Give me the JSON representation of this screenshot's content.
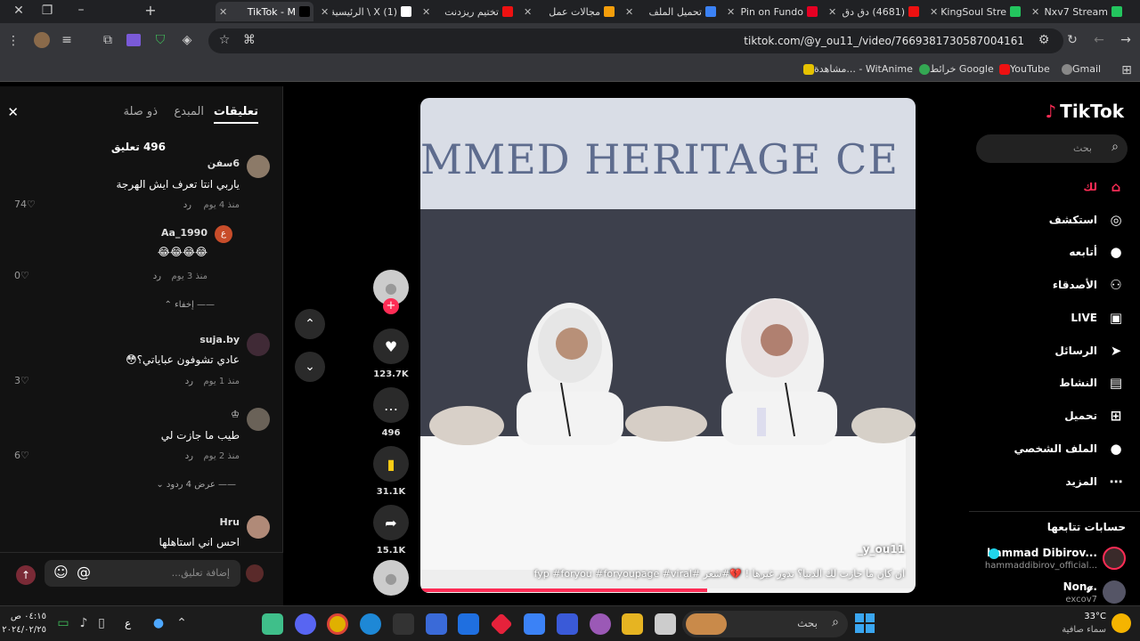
{
  "browser": {
    "tabs": [
      {
        "label": "Nxv7 Stream",
        "color": "#23c55e"
      },
      {
        "label": "KingSoul Stre",
        "color": "#23c55e"
      },
      {
        "label": "(4681) دق دق",
        "color": "#e11"
      },
      {
        "label": "Pin on Fundo",
        "color": "#e60023"
      },
      {
        "label": "تحميل الملف",
        "color": "#3b82f6"
      },
      {
        "label": "مجالات عمل",
        "color": "#f59e0b"
      },
      {
        "label": "تختيم ريزدنت",
        "color": "#e11"
      },
      {
        "label": "(1) X \\ الرئيسية",
        "color": "#fff"
      },
      {
        "label": "TikTok - M",
        "color": "#000"
      }
    ],
    "url": "tiktok.com/@y_ou11_/video/7669381730587004161",
    "bookmarks": [
      "Gmail",
      "YouTube",
      "خرائط Google",
      "مشاهدة... - WitAnime"
    ]
  },
  "comments_panel": {
    "tabs": [
      "تعليقات",
      "المبدع",
      "ذو صلة"
    ],
    "count": "496 تعليق",
    "comments": [
      {
        "user": "6سفن",
        "text": "ياربي انتا تعرف ايش الهرجة",
        "time": "منذ 4 يوم",
        "reply": "رد",
        "likes": "74"
      },
      {
        "user": "Aa_1990",
        "badge": "ع",
        "text": "😂😂😂😂",
        "time": "منذ 3 يوم",
        "reply": "رد",
        "likes": "0"
      },
      {
        "user": "suja.by",
        "text": "عادي تشوفون عباياتي؟😳",
        "time": "منذ 1 يوم",
        "reply": "رد",
        "likes": "3"
      },
      {
        "user": "♔",
        "text": "طيب ما جازت لي",
        "time": "منذ 2 يوم",
        "reply": "رد",
        "likes": "6"
      },
      {
        "user": "Hru",
        "text": "احس اني استاهلها",
        "time": "",
        "reply": "",
        "likes": ""
      }
    ],
    "hide_label": "إخفاء",
    "show_replies_label": "عرض 4 ردود",
    "input_placeholder": "إضافة تعليق..."
  },
  "video": {
    "banner_text": "MMED HERITAGE CE",
    "author": "_y_ou11",
    "caption": "ان كان ما جازت لك الدنيا؟ ندور غيرها ! 💔#شعر #fyp #foryou #foryoupage #viral",
    "progress": 0.58
  },
  "actions": {
    "likes": "123.7K",
    "comments": "496",
    "saves": "31.1K",
    "shares": "15.1K"
  },
  "sidebar": {
    "logo": "TikTok",
    "search_placeholder": "بحث",
    "nav": [
      {
        "label": "لك",
        "icon": "home-icon",
        "glyph": "⌂",
        "active": true
      },
      {
        "label": "استكشف",
        "icon": "compass-icon",
        "glyph": "◎"
      },
      {
        "label": "أتابعه",
        "icon": "following-avatar-icon",
        "glyph": "●"
      },
      {
        "label": "الأصدقاء",
        "icon": "friends-icon",
        "glyph": "⚇"
      },
      {
        "label": "LIVE",
        "icon": "live-icon",
        "glyph": "▣"
      },
      {
        "label": "الرسائل",
        "icon": "messages-icon",
        "glyph": "➤"
      },
      {
        "label": "النشاط",
        "icon": "activity-icon",
        "glyph": "▤"
      },
      {
        "label": "تحميل",
        "icon": "upload-icon",
        "glyph": "⊞"
      },
      {
        "label": "الملف الشخصي",
        "icon": "profile-icon",
        "glyph": "●"
      },
      {
        "label": "المزيد",
        "icon": "more-icon",
        "glyph": "⋯"
      }
    ],
    "following_title": "حسابات تتابعها",
    "following": [
      {
        "name": "hammad Dibirov...",
        "handle": "hammaddibirov_official..."
      },
      {
        "name": "Non𝓰.",
        "handle": "excov7"
      }
    ]
  },
  "taskbar": {
    "search_placeholder": "بحث",
    "temp": "33°C",
    "weather": "سماء صافية",
    "time": "٠٤:١٥ ص",
    "date": "٢٠٢٤/٠٢/٢٥",
    "lang": "ع"
  }
}
